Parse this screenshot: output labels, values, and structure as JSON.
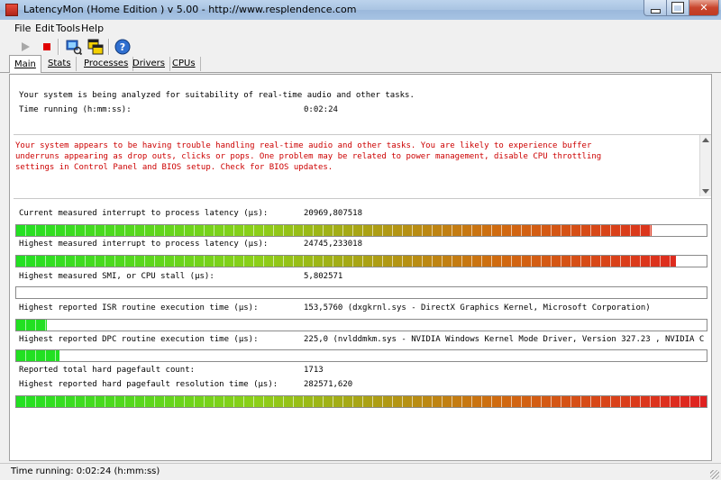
{
  "window": {
    "title": "LatencyMon  (Home Edition )  v 5.00 - http://www.resplendence.com"
  },
  "menu": [
    "File",
    "Edit",
    "Tools",
    "Help"
  ],
  "toolbar": {
    "icons": [
      "play-icon",
      "stop-icon",
      "monitor-icon",
      "copy-windows-icon",
      "help-icon"
    ]
  },
  "tabs": [
    "Main",
    "Stats",
    "Processes",
    "Drivers",
    "CPUs"
  ],
  "active_tab": "Main",
  "status": {
    "analyzing": "Your system is being analyzed for suitability of real-time audio and other tasks.",
    "time_label": "Time running (h:mm:ss):",
    "time_value": "0:02:24"
  },
  "warning": {
    "text": "Your system appears to be having trouble handling real-time audio and other tasks. You are likely to experience buffer\nunderruns appearing as drop outs, clicks or pops. One problem may be related to power management, disable CPU throttling\nsettings in Control Panel and BIOS setup. Check for BIOS updates.",
    "color": "#cc0000"
  },
  "metrics": [
    {
      "label": "Current measured interrupt to process latency (µs):",
      "value": "20969,807518",
      "meter_level": 0.92,
      "style": "gradient"
    },
    {
      "label": "Highest measured interrupt to process latency (µs):",
      "value": "24745,233018",
      "meter_level": 0.955,
      "style": "gradient"
    },
    {
      "label": "Highest measured SMI, or CPU stall (µs):",
      "value": "5,802571",
      "meter_level": 0.0,
      "style": "gradient"
    },
    {
      "label": "Highest reported ISR routine execution time (µs):",
      "value": "153,5760   (dxgkrnl.sys - DirectX Graphics Kernel, Microsoft Corporation)",
      "meter_level": 0.045,
      "style": "green"
    },
    {
      "label": "Highest reported DPC routine execution time (µs):",
      "value": "225,0   (nvlddmkm.sys - NVIDIA Windows Kernel Mode Driver, Version 327.23 , NVIDIA C",
      "meter_level": 0.063,
      "style": "green"
    },
    {
      "label": "Reported total hard pagefault count:",
      "value": "1713",
      "meter_level": null,
      "style": "none"
    },
    {
      "label": "Highest reported hard pagefault resolution time (µs):",
      "value": "282571,620",
      "meter_level": 1.0,
      "style": "gradient"
    }
  ],
  "statusbar": {
    "text": "Time running: 0:02:24  (h:mm:ss)"
  },
  "colors": {
    "meter_green": "#22e022",
    "meter_red": "#e02020",
    "warning_red": "#cc0000"
  }
}
